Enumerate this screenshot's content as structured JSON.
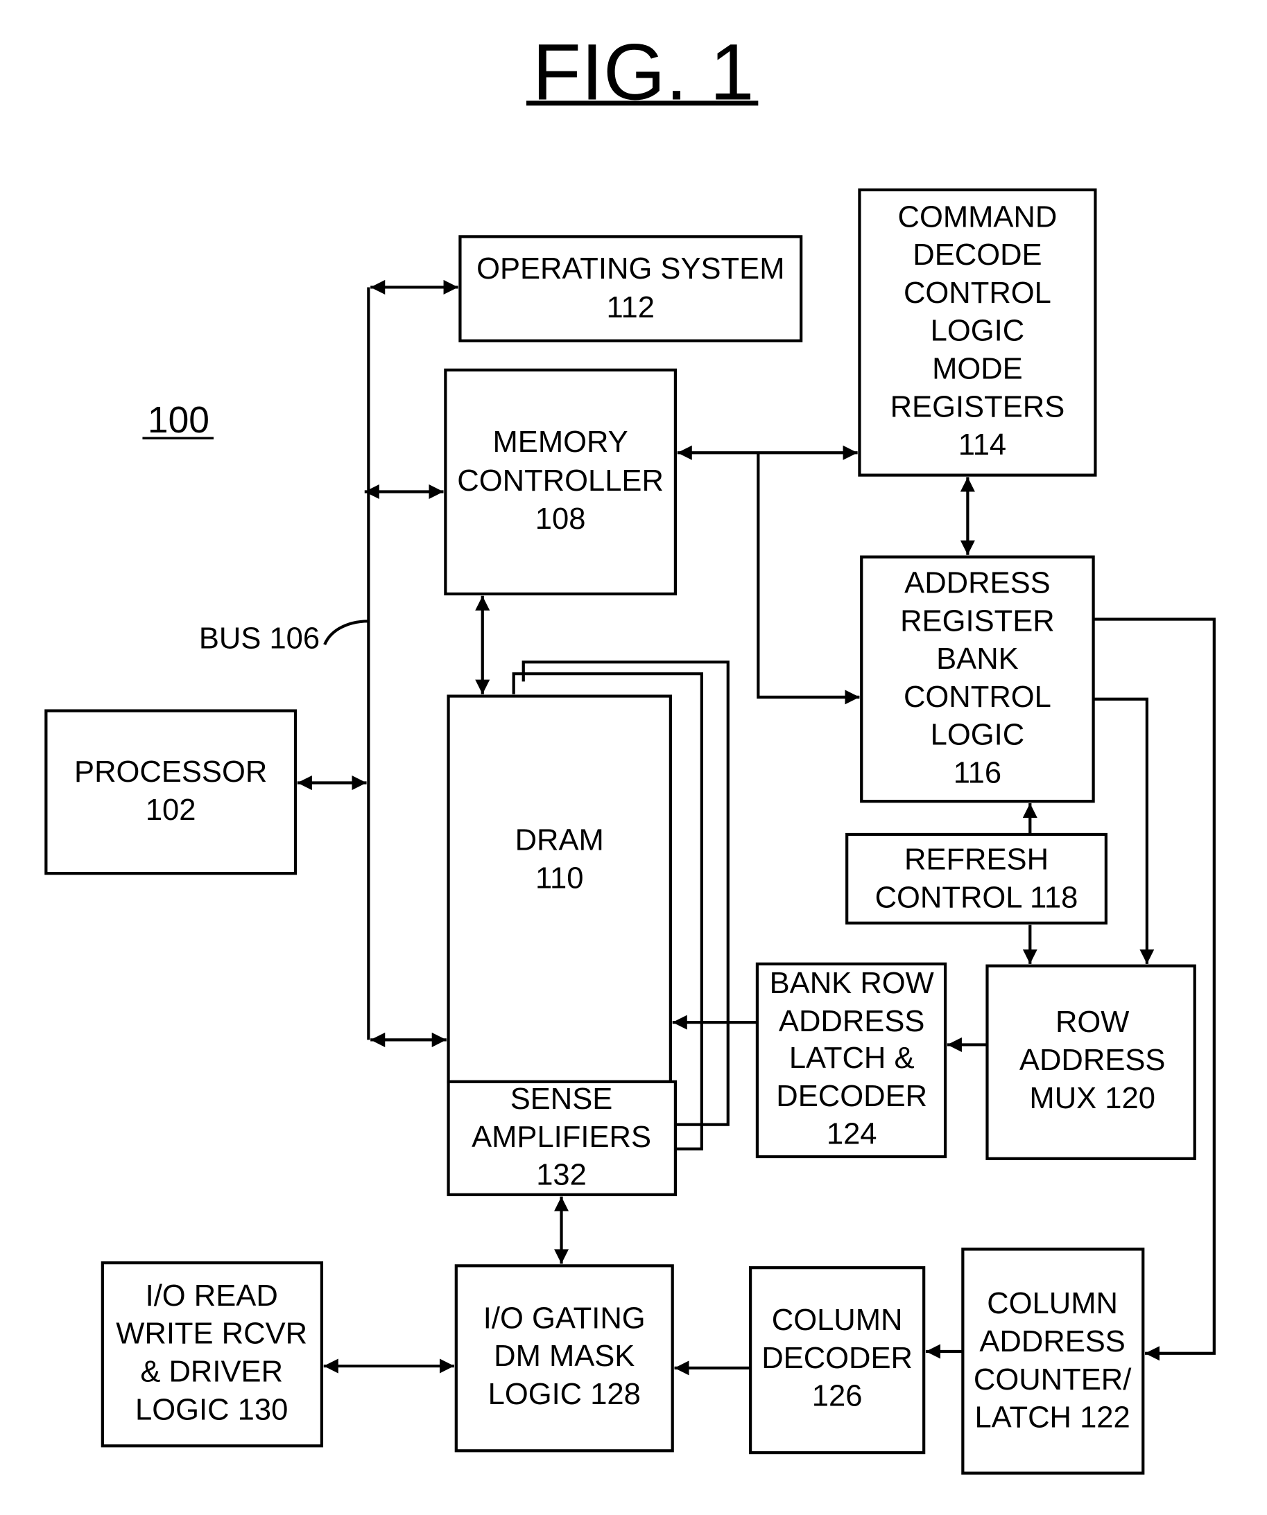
{
  "figure": {
    "title": "FIG. 1",
    "reference_numeral": "100",
    "bus_label": "BUS 106"
  },
  "blocks": {
    "operating_system": [
      "OPERATING SYSTEM",
      "112"
    ],
    "memory_controller": [
      "MEMORY",
      "CONTROLLER",
      "108"
    ],
    "command_decode": [
      "COMMAND",
      "DECODE",
      "CONTROL",
      "LOGIC",
      "MODE",
      "REGISTERS",
      "114"
    ],
    "address_register": [
      "ADDRESS",
      "REGISTER",
      "BANK",
      "CONTROL",
      "LOGIC",
      "116"
    ],
    "refresh_control": [
      "REFRESH",
      "CONTROL 118"
    ],
    "processor": [
      "PROCESSOR",
      "102"
    ],
    "dram": [
      "DRAM",
      "110"
    ],
    "sense_amplifiers": [
      "SENSE",
      "AMPLIFIERS",
      "132"
    ],
    "bank_row_latch": [
      "BANK ROW",
      "ADDRESS",
      "LATCH &",
      "DECODER",
      "124"
    ],
    "row_address_mux": [
      "ROW",
      "ADDRESS",
      "MUX 120"
    ],
    "io_read_write": [
      "I/O READ",
      "WRITE RCVR",
      "& DRIVER",
      "LOGIC 130"
    ],
    "io_gating": [
      "I/O GATING",
      "DM MASK",
      "LOGIC 128"
    ],
    "column_decoder": [
      "COLUMN",
      "DECODER",
      "126"
    ],
    "column_address_counter": [
      "COLUMN",
      "ADDRESS",
      "COUNTER/",
      "LATCH 122"
    ]
  }
}
